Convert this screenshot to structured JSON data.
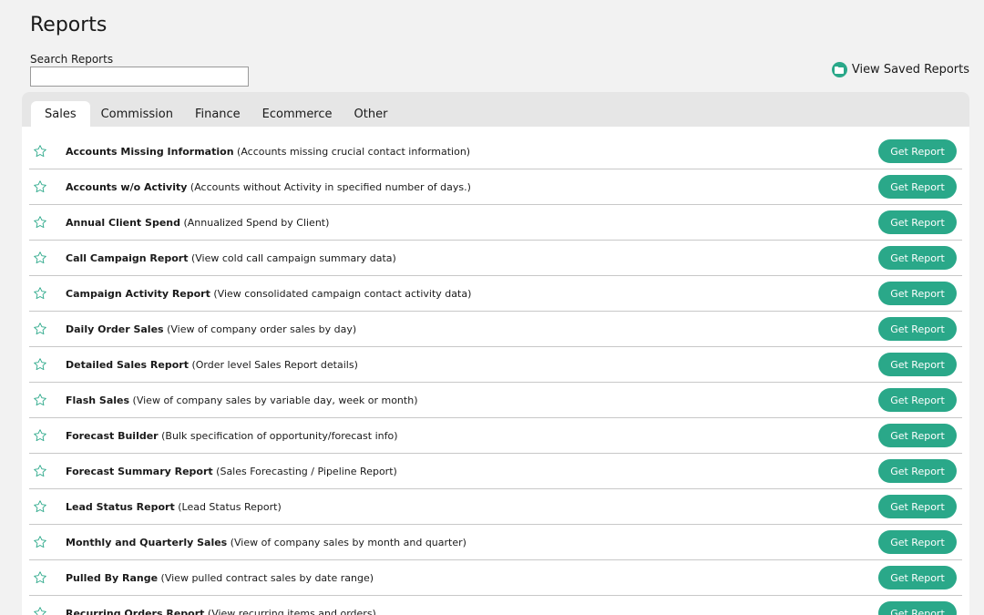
{
  "page": {
    "title": "Reports"
  },
  "search": {
    "label": "Search Reports",
    "value": "",
    "placeholder": ""
  },
  "saved_link": {
    "label": "View Saved Reports",
    "icon": "folder-icon"
  },
  "colors": {
    "accent": "#2aa889",
    "star_outline": "#2aa889"
  },
  "tabs": [
    {
      "label": "Sales",
      "active": true
    },
    {
      "label": "Commission",
      "active": false
    },
    {
      "label": "Finance",
      "active": false
    },
    {
      "label": "Ecommerce",
      "active": false
    },
    {
      "label": "Other",
      "active": false
    }
  ],
  "button_label": "Get Report",
  "reports": [
    {
      "name": "Accounts Missing Information",
      "desc": "(Accounts missing crucial contact information)"
    },
    {
      "name": "Accounts w/o Activity",
      "desc": "(Accounts without Activity in specified number of days.)"
    },
    {
      "name": "Annual Client Spend",
      "desc": "(Annualized Spend by Client)"
    },
    {
      "name": "Call Campaign Report",
      "desc": "(View cold call campaign summary data)"
    },
    {
      "name": "Campaign Activity Report",
      "desc": "(View consolidated campaign contact activity data)"
    },
    {
      "name": "Daily Order Sales",
      "desc": "(View of company order sales by day)"
    },
    {
      "name": "Detailed Sales Report",
      "desc": "(Order level Sales Report details)"
    },
    {
      "name": "Flash Sales",
      "desc": "(View of company sales by variable day, week or month)"
    },
    {
      "name": "Forecast Builder",
      "desc": "(Bulk specification of opportunity/forecast info)"
    },
    {
      "name": "Forecast Summary Report",
      "desc": "(Sales Forecasting / Pipeline Report)"
    },
    {
      "name": "Lead Status Report",
      "desc": "(Lead Status Report)"
    },
    {
      "name": "Monthly and Quarterly Sales",
      "desc": "(View of company sales by month and quarter)"
    },
    {
      "name": "Pulled By Range",
      "desc": "(View pulled contract sales by date range)"
    },
    {
      "name": "Recurring Orders Report",
      "desc": "(View recurring items and orders)"
    }
  ]
}
